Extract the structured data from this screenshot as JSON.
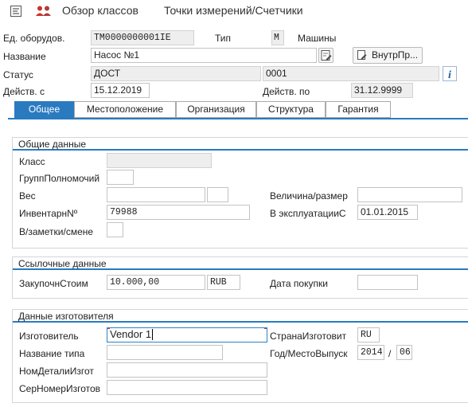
{
  "toolbar": {
    "class_overview": "Обзор классов",
    "measuring_points": "Точки измерений/Счетчики"
  },
  "header": {
    "equipment_label": "Ед. оборудов.",
    "equipment_value": "TM0000000001IE",
    "type_label": "Тип",
    "type_value": "M",
    "type_desc": "Машины",
    "name_label": "Название",
    "name_value": "Насос №1",
    "intern_button": "ВнутрПр...",
    "status_label": "Статус",
    "status_value": "ДОСТ",
    "status_user_value": "0001",
    "valid_from_label": "Действ. с",
    "valid_from_value": "15.12.2019",
    "valid_to_label": "Действ. по",
    "valid_to_value": "31.12.9999"
  },
  "tabs": [
    {
      "label": "Общее",
      "active": true
    },
    {
      "label": "Местоположение",
      "active": false
    },
    {
      "label": "Организация",
      "active": false
    },
    {
      "label": "Структура",
      "active": false
    },
    {
      "label": "Гарантия",
      "active": false
    }
  ],
  "general": {
    "title": "Общие данные",
    "class_label": "Класс",
    "class_value": "",
    "auth_group_label": "ГруппПолномочий",
    "auth_group_value": "",
    "weight_label": "Вес",
    "weight_value": "",
    "weight_unit": "",
    "size_label": "Величина/размер",
    "size_value": "",
    "inventory_label": "ИнвентарнNº",
    "inventory_value": "79988",
    "startup_label": "В эксплуатацииС",
    "startup_value": "01.01.2015",
    "shift_note_label": "В/заметки/смене",
    "shift_note_value": ""
  },
  "reference": {
    "title": "Ссылочные данные",
    "acq_value_label": "ЗакупочнСтоим",
    "acq_value": "10.000,00",
    "currency": "RUB",
    "acq_date_label": "Дата покупки",
    "acq_date_value": ""
  },
  "manufacturer": {
    "title": "Данные изготовителя",
    "manufacturer_label": "Изготовитель",
    "manufacturer_value": "Vendor 1",
    "country_label": "СтранаИзготовит",
    "country_value": "RU",
    "model_label": "Название типа",
    "model_value": "",
    "constr_label": "Год/МестоВыпуск",
    "constr_year": "2014",
    "constr_sep": "/",
    "constr_month": "06",
    "part_no_label": "НомДеталиИзгот",
    "part_no_value": "",
    "serial_label": "СерНомерИзготов",
    "serial_value": ""
  },
  "colors": {
    "accent": "#2a7ac0",
    "focus_marker": "#d8312c"
  }
}
